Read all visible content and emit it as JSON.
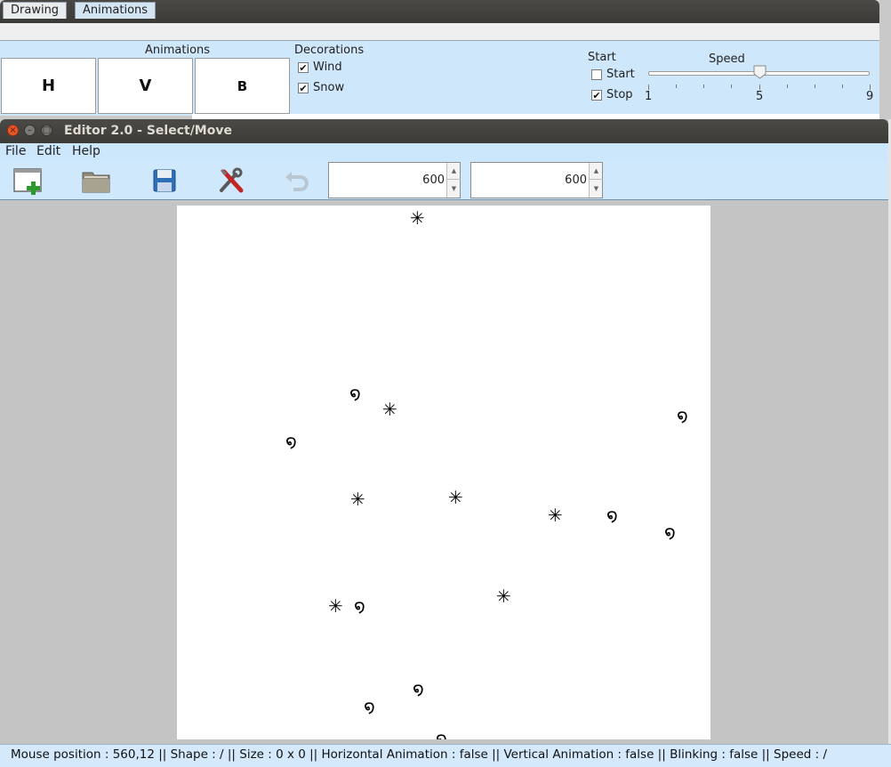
{
  "top_window": {
    "tabs": [
      {
        "label": "Drawing",
        "selected": false
      },
      {
        "label": "Animations",
        "selected": true
      }
    ],
    "animations": {
      "label": "Animations",
      "buttons": [
        "H",
        "V",
        "B"
      ]
    },
    "decorations": {
      "label": "Decorations",
      "wind": {
        "label": "Wind",
        "checked": true
      },
      "snow": {
        "label": "Snow",
        "checked": true
      }
    },
    "start_group": {
      "label": "Start",
      "start": {
        "label": "Start",
        "checked": false
      },
      "stop": {
        "label": "Stop",
        "checked": true
      }
    },
    "speed": {
      "label": "Speed",
      "min": 1,
      "max": 9,
      "value": 5,
      "tick_labels": [
        "1",
        "5",
        "9"
      ]
    }
  },
  "editor": {
    "title": "Editor 2.0 - Select/Move",
    "menu": [
      "File",
      "Edit",
      "Help"
    ],
    "toolbar": {
      "icons": [
        "new-image-icon",
        "open-folder-icon",
        "save-disk-icon",
        "tools-icon",
        "undo-icon"
      ],
      "width_value": "600",
      "height_value": "600"
    },
    "canvas": {
      "snowflake_glyph": "✳",
      "wind_glyph": "໑"
    },
    "status": {
      "text": "Mouse position : 560,12 ||  Shape : / ||  Size : 0 x 0 ||  Horizontal Animation : false ||  Vertical Animation : false ||  Blinking : false ||  Speed : /"
    }
  },
  "colors": {
    "panel_blue": "#cfe7fb",
    "titlebar_dark": "#3c3b37",
    "close_orange": "#e9562a"
  }
}
